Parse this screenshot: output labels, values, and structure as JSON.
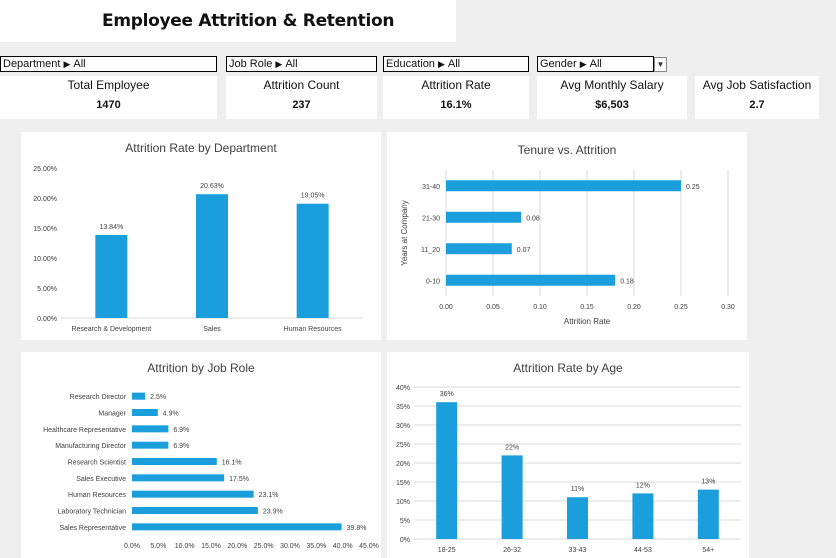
{
  "header": {
    "title": "Employee Attrition & Retention"
  },
  "filters": [
    {
      "label": "Department",
      "value": "All"
    },
    {
      "label": "Job Role",
      "value": "All"
    },
    {
      "label": "Education",
      "value": "All"
    },
    {
      "label": "Gender",
      "value": "All"
    }
  ],
  "kpis": [
    {
      "label": "Total Employee",
      "value": "1470"
    },
    {
      "label": "Attrition Count",
      "value": "237"
    },
    {
      "label": "Attrition Rate",
      "value": "16.1%"
    },
    {
      "label": "Avg  Monthly Salary",
      "value": "$6,503"
    },
    {
      "label": "Avg Job Satisfaction",
      "value": "2.7"
    }
  ],
  "chart_data": [
    {
      "type": "bar",
      "title": "Attrition Rate by Department",
      "categories": [
        "Research & Development",
        "Sales",
        "Human Resources"
      ],
      "values": [
        13.84,
        20.63,
        19.05
      ],
      "data_labels": [
        "13.84%",
        "20.63%",
        "19.05%"
      ],
      "yticks": [
        "0.00%",
        "5.00%",
        "10.00%",
        "15.00%",
        "20.00%",
        "25.00%"
      ],
      "ylim": [
        0,
        25
      ],
      "grid": false,
      "bar_color": "#1a9fdc"
    },
    {
      "type": "bar",
      "orientation": "horizontal",
      "title": "Tenure vs. Attrition",
      "categories": [
        "31-40",
        "21-30",
        "11_20",
        "0-10"
      ],
      "values": [
        0.25,
        0.08,
        0.07,
        0.18
      ],
      "data_labels": [
        "0.25",
        "0.08",
        "0.07",
        "0.18"
      ],
      "xticks": [
        "0.00",
        "0.05",
        "0.10",
        "0.15",
        "0.20",
        "0.25",
        "0.30"
      ],
      "xlim": [
        0,
        0.3
      ],
      "xlabel": "Attrition Rate",
      "ylabel": "Years at Company",
      "grid": true,
      "bar_color": "#1a9fdc"
    },
    {
      "type": "bar",
      "orientation": "horizontal",
      "title": "Attrition by Job Role",
      "categories": [
        "Research Director",
        "Manager",
        "Healthcare Representative",
        "Manufacturing Director",
        "Research Scientist",
        "Sales Executive",
        "Human Resources",
        "Laboratory Technician",
        "Sales Representative"
      ],
      "values": [
        2.5,
        4.9,
        6.9,
        6.9,
        16.1,
        17.5,
        23.1,
        23.9,
        39.8
      ],
      "data_labels": [
        "2.5%",
        "4.9%",
        "6.9%",
        "6.9%",
        "16.1%",
        "17.5%",
        "23.1%",
        "23.9%",
        "39.8%"
      ],
      "xticks": [
        "0.0%",
        "5.0%",
        "10.0%",
        "15.0%",
        "20.0%",
        "25.0%",
        "30.0%",
        "35.0%",
        "40.0%",
        "45.0%"
      ],
      "xlim": [
        0,
        45
      ],
      "grid": false,
      "bar_color": "#1a9fdc"
    },
    {
      "type": "bar",
      "title": "Attrition Rate by Age",
      "categories": [
        "18-25",
        "26-32",
        "33-43",
        "44-53",
        "54+"
      ],
      "values": [
        36,
        22,
        11,
        12,
        13
      ],
      "data_labels": [
        "36%",
        "22%",
        "11%",
        "12%",
        "13%"
      ],
      "yticks": [
        "0%",
        "5%",
        "10%",
        "15%",
        "20%",
        "25%",
        "30%",
        "35%",
        "40%"
      ],
      "ylim": [
        0,
        40
      ],
      "grid": true,
      "bar_color": "#1a9fdc"
    }
  ]
}
